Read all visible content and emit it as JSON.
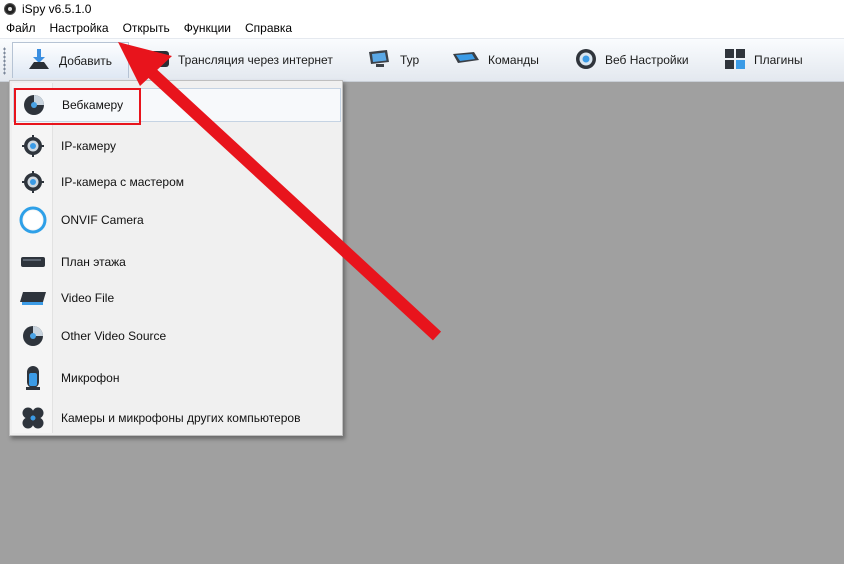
{
  "window": {
    "title": "iSpy v6.5.1.0"
  },
  "menubar": {
    "items": [
      {
        "label": "Файл"
      },
      {
        "label": "Настройка"
      },
      {
        "label": "Открыть"
      },
      {
        "label": "Функции"
      },
      {
        "label": "Справка"
      }
    ]
  },
  "toolbar": {
    "add": "Добавить",
    "broadcast": "Трансляция через интернет",
    "tour": "Тур",
    "commands": "Команды",
    "web_settings": "Веб Настройки",
    "plugins": "Плагины"
  },
  "dropdown": {
    "items": [
      {
        "label": "Вебкамеру",
        "icon": "webcam-icon"
      },
      {
        "label": "IP-камеру",
        "icon": "ip-camera-icon"
      },
      {
        "label": "IP-камера с мастером",
        "icon": "ip-camera-wizard-icon"
      },
      {
        "label": "ONVIF Camera",
        "icon": "onvif-ring-icon"
      },
      {
        "label": "План этажа",
        "icon": "floor-plan-icon"
      },
      {
        "label": "Video File",
        "icon": "video-file-icon"
      },
      {
        "label": "Other Video Source",
        "icon": "video-source-icon"
      },
      {
        "label": "Микрофон",
        "icon": "microphone-icon"
      },
      {
        "label": "Камеры и микрофоны других компьютеров",
        "icon": "remote-devices-icon"
      }
    ]
  },
  "colors": {
    "annotation_red": "#e8141c",
    "workspace": "#a0a0a0",
    "menu_background": "#f0f0f0"
  }
}
